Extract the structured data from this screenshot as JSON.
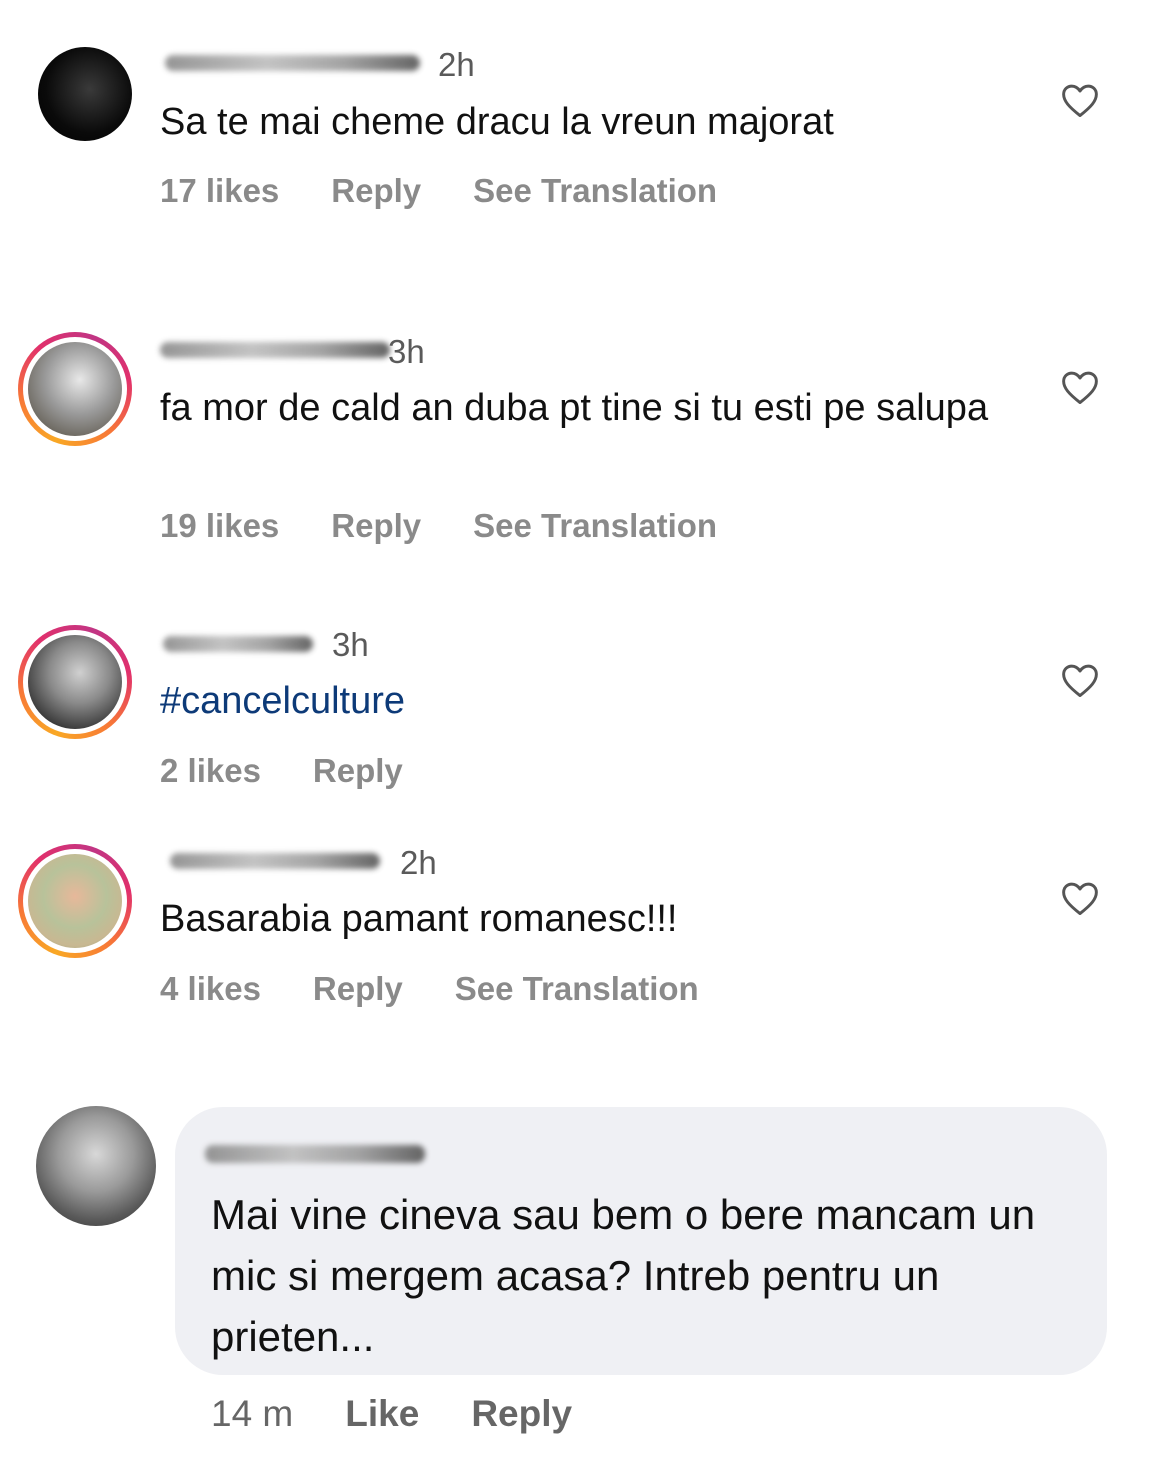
{
  "comments": [
    {
      "time": "2h",
      "text": "Sa te mai cheme dracu la vreun majorat",
      "likes": "17 likes",
      "reply": "Reply",
      "translate": "See Translation",
      "has_story_ring": false
    },
    {
      "time": "3h",
      "text": "fa mor de cald an duba pt tine si tu esti pe salupa",
      "likes": "19 likes",
      "reply": "Reply",
      "translate": "See Translation",
      "has_story_ring": true
    },
    {
      "time": "3h",
      "text": "#cancelculture",
      "likes": "2 likes",
      "reply": "Reply",
      "has_story_ring": true
    },
    {
      "time": "2h",
      "text": "Basarabia pamant romanesc!!!",
      "likes": "4 likes",
      "reply": "Reply",
      "translate": "See Translation",
      "has_story_ring": true
    }
  ],
  "facebook_comment": {
    "text": "Mai vine cineva sau bem o bere mancam un mic si mergem acasa? Intreb pentru un prieten...",
    "time": "14 m",
    "like": "Like",
    "reply": "Reply"
  },
  "colors": {
    "hashtag": "#0d3a78",
    "action_gray": "#8a8a8a",
    "bubble_bg": "#eff0f4"
  },
  "icons": [
    "heart-outline-icon"
  ]
}
